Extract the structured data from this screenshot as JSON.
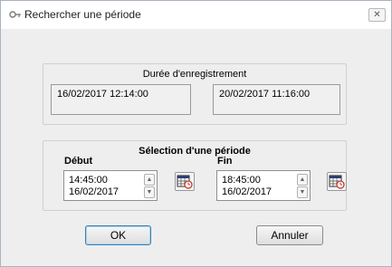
{
  "window": {
    "title": "Rechercher une période",
    "close_glyph": "✕"
  },
  "recording": {
    "title": "Durée d'enregistrement",
    "start": "16/02/2017 12:14:00",
    "end": "20/02/2017 11:16:00"
  },
  "selection": {
    "title": "Sélection d'une période",
    "start": {
      "label": "Début",
      "time": "14:45:00",
      "date": "16/02/2017"
    },
    "end": {
      "label": "Fin",
      "time": "18:45:00",
      "date": "16/02/2017"
    }
  },
  "buttons": {
    "ok": "OK",
    "cancel": "Annuler"
  },
  "icons": {
    "app": "key-icon",
    "close": "close-icon",
    "spin_up": "chevron-up-icon",
    "spin_down": "chevron-down-icon",
    "calendar": "calendar-clock-icon"
  },
  "colors": {
    "accent": "#3c7fb1",
    "calendar_red": "#c0392b"
  }
}
